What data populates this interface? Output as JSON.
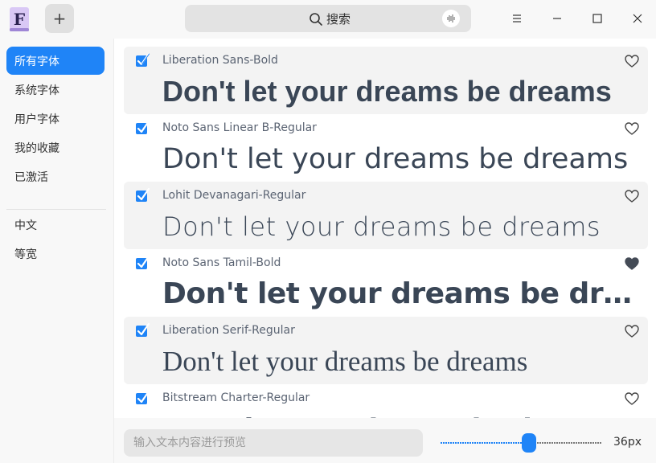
{
  "titlebar": {
    "app_icon_letter": "F",
    "add_label": "+",
    "search_label": "搜索"
  },
  "sidebar": {
    "items": [
      {
        "label": "所有字体",
        "active": true
      },
      {
        "label": "系统字体",
        "active": false
      },
      {
        "label": "用户字体",
        "active": false
      },
      {
        "label": "我的收藏",
        "active": false
      },
      {
        "label": "已激活",
        "active": false
      }
    ],
    "groups": [
      {
        "label": "中文"
      },
      {
        "label": "等宽"
      }
    ]
  },
  "preview_text": "Don't let your dreams be dreams",
  "fonts": [
    {
      "name": "Liberation Sans-Bold",
      "checked": true,
      "favorite": false,
      "preview": "Don't let your dreams be dreams"
    },
    {
      "name": "Noto Sans Linear B-Regular",
      "checked": true,
      "favorite": false,
      "preview": "Don't let your dreams be dreams"
    },
    {
      "name": "Lohit Devanagari-Regular",
      "checked": true,
      "favorite": false,
      "preview": "Don't let your dreams be dreams"
    },
    {
      "name": "Noto Sans Tamil-Bold",
      "checked": true,
      "favorite": true,
      "preview": "Don't let your dreams be drea..."
    },
    {
      "name": "Liberation Serif-Regular",
      "checked": true,
      "favorite": false,
      "preview": "Don't let your dreams be dreams"
    },
    {
      "name": "Bitstream Charter-Regular",
      "checked": true,
      "favorite": false,
      "preview": "Don't let your dreams be dreams"
    }
  ],
  "bottom": {
    "input_placeholder": "输入文本内容进行预览",
    "size_value": 36,
    "size_min": 6,
    "size_max": 60,
    "size_label": "36px"
  },
  "colors": {
    "accent": "#1f84f7",
    "text": "#3a4656"
  }
}
